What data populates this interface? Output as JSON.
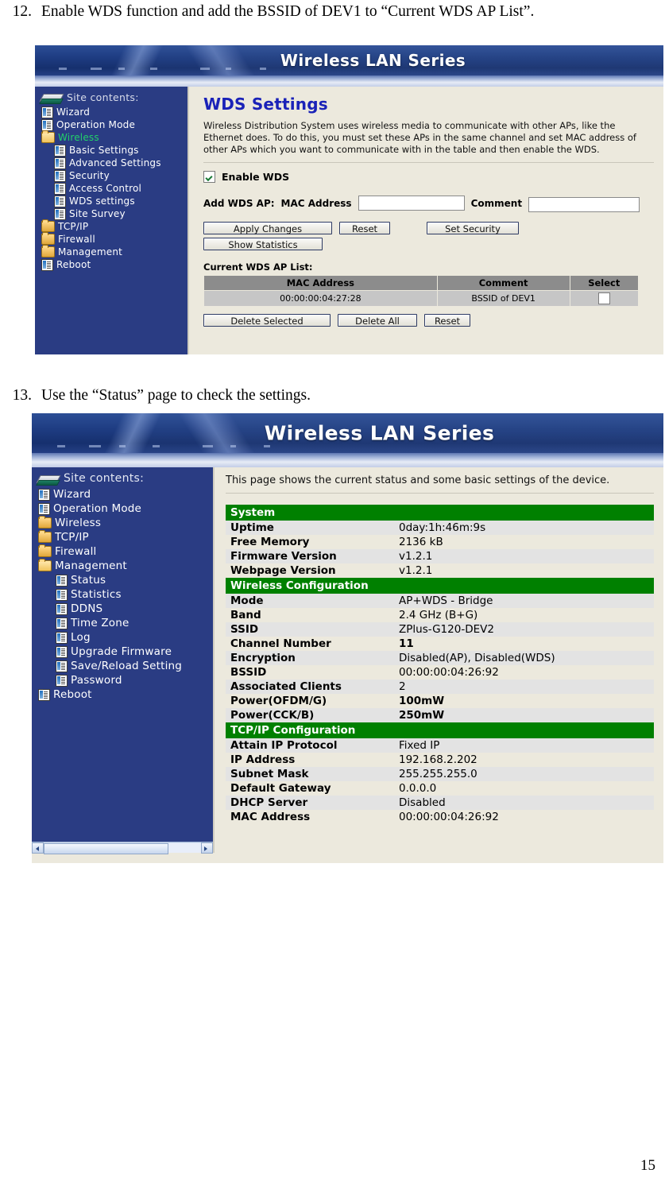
{
  "document": {
    "steps": [
      {
        "number": "12.",
        "text": "Enable WDS function and add the BSSID of DEV1 to “Current WDS AP List”."
      },
      {
        "number": "13.",
        "text": "Use the “Status” page to check the settings."
      }
    ],
    "page_number": "15"
  },
  "shot1": {
    "banner_title": "Wireless LAN Series",
    "sidebar": {
      "heading": "Site contents:",
      "items": [
        {
          "label": "Wizard",
          "icon": "page-icon",
          "indent": false,
          "active": false
        },
        {
          "label": "Operation Mode",
          "icon": "page-icon",
          "indent": false,
          "active": false
        },
        {
          "label": "Wireless",
          "icon": "folder-open-icon",
          "indent": false,
          "active": true
        },
        {
          "label": "Basic Settings",
          "icon": "page-icon",
          "indent": true,
          "active": false
        },
        {
          "label": "Advanced Settings",
          "icon": "page-icon",
          "indent": true,
          "active": false
        },
        {
          "label": "Security",
          "icon": "page-icon",
          "indent": true,
          "active": false
        },
        {
          "label": "Access Control",
          "icon": "page-icon",
          "indent": true,
          "active": false
        },
        {
          "label": "WDS settings",
          "icon": "page-icon",
          "indent": true,
          "active": false
        },
        {
          "label": "Site Survey",
          "icon": "page-icon",
          "indent": true,
          "active": false
        },
        {
          "label": "TCP/IP",
          "icon": "folder-icon",
          "indent": false,
          "active": false
        },
        {
          "label": "Firewall",
          "icon": "folder-icon",
          "indent": false,
          "active": false
        },
        {
          "label": "Management",
          "icon": "folder-icon",
          "indent": false,
          "active": false
        },
        {
          "label": "Reboot",
          "icon": "page-icon",
          "indent": false,
          "active": false
        }
      ]
    },
    "page_title": "WDS Settings",
    "description": "Wireless Distribution System uses wireless media to communicate with other APs, like the Ethernet does. To do this, you must set these APs in the same channel and set MAC address of other APs which you want to communicate with in the table and then enable the WDS.",
    "enable_wds_label": "Enable WDS",
    "enable_wds_checked": true,
    "add_wds_label": "Add WDS AP:",
    "mac_address_label": "MAC Address",
    "mac_address_value": "",
    "comment_label": "Comment",
    "comment_value": "",
    "buttons": {
      "apply_changes": "Apply Changes",
      "reset": "Reset",
      "set_security": "Set Security",
      "show_statistics": "Show Statistics",
      "delete_selected": "Delete Selected",
      "delete_all": "Delete All",
      "reset2": "Reset"
    },
    "list_label": "Current WDS AP List:",
    "table": {
      "headers": [
        "MAC Address",
        "Comment",
        "Select"
      ],
      "rows": [
        {
          "mac": "00:00:00:04:27:28",
          "comment": "BSSID of DEV1",
          "selected": false
        }
      ]
    }
  },
  "shot2": {
    "banner_title": "Wireless LAN Series",
    "sidebar": {
      "heading": "Site contents:",
      "items": [
        {
          "label": "Wizard",
          "icon": "page-icon",
          "indent": false
        },
        {
          "label": "Operation Mode",
          "icon": "page-icon",
          "indent": false
        },
        {
          "label": "Wireless",
          "icon": "folder-icon",
          "indent": false
        },
        {
          "label": "TCP/IP",
          "icon": "folder-icon",
          "indent": false
        },
        {
          "label": "Firewall",
          "icon": "folder-icon",
          "indent": false
        },
        {
          "label": "Management",
          "icon": "folder-open-icon",
          "indent": false
        },
        {
          "label": "Status",
          "icon": "page-icon",
          "indent": true
        },
        {
          "label": "Statistics",
          "icon": "page-icon",
          "indent": true
        },
        {
          "label": "DDNS",
          "icon": "page-icon",
          "indent": true
        },
        {
          "label": "Time Zone",
          "icon": "page-icon",
          "indent": true
        },
        {
          "label": "Log",
          "icon": "page-icon",
          "indent": true
        },
        {
          "label": "Upgrade Firmware",
          "icon": "page-icon",
          "indent": true
        },
        {
          "label": "Save/Reload Setting",
          "icon": "page-icon",
          "indent": true
        },
        {
          "label": "Password",
          "icon": "page-icon",
          "indent": true
        },
        {
          "label": "Reboot",
          "icon": "page-icon",
          "indent": false
        }
      ]
    },
    "description": "This page shows the current status and some basic settings of the device.",
    "sections": [
      {
        "title": "System",
        "rows": [
          {
            "key": "Uptime",
            "value": "0day:1h:46m:9s",
            "bold_value": false
          },
          {
            "key": "Free Memory",
            "value": "2136 kB",
            "bold_value": false
          },
          {
            "key": "Firmware Version",
            "value": "v1.2.1",
            "bold_value": false
          },
          {
            "key": "Webpage Version",
            "value": "v1.2.1",
            "bold_value": false
          }
        ]
      },
      {
        "title": "Wireless Configuration",
        "rows": [
          {
            "key": "Mode",
            "value": "AP+WDS - Bridge",
            "bold_value": false
          },
          {
            "key": "Band",
            "value": "2.4 GHz (B+G)",
            "bold_value": false
          },
          {
            "key": "SSID",
            "value": "ZPlus-G120-DEV2",
            "bold_value": false
          },
          {
            "key": "Channel Number",
            "value": "11",
            "bold_value": true
          },
          {
            "key": "Encryption",
            "value": "Disabled(AP), Disabled(WDS)",
            "bold_value": false
          },
          {
            "key": "BSSID",
            "value": "00:00:00:04:26:92",
            "bold_value": false
          },
          {
            "key": "Associated Clients",
            "value": "2",
            "bold_value": false
          },
          {
            "key": "Power(OFDM/G)",
            "value": "100mW",
            "bold_value": true
          },
          {
            "key": "Power(CCK/B)",
            "value": "250mW",
            "bold_value": true
          }
        ]
      },
      {
        "title": "TCP/IP Configuration",
        "rows": [
          {
            "key": "Attain IP Protocol",
            "value": "Fixed IP",
            "bold_value": false
          },
          {
            "key": "IP Address",
            "value": "192.168.2.202",
            "bold_value": false
          },
          {
            "key": "Subnet Mask",
            "value": "255.255.255.0",
            "bold_value": false
          },
          {
            "key": "Default Gateway",
            "value": "0.0.0.0",
            "bold_value": false
          },
          {
            "key": "DHCP Server",
            "value": "Disabled",
            "bold_value": false
          },
          {
            "key": "MAC Address",
            "value": "00:00:00:04:26:92",
            "bold_value": false
          }
        ]
      }
    ]
  },
  "colors": {
    "banner_blue": "#1e3c82",
    "sidebar_blue": "#2a3c83",
    "content_cream": "#ece9dd",
    "title_blue": "#1a22b8",
    "section_green": "#008000",
    "active_link_green": "#22d06a"
  }
}
